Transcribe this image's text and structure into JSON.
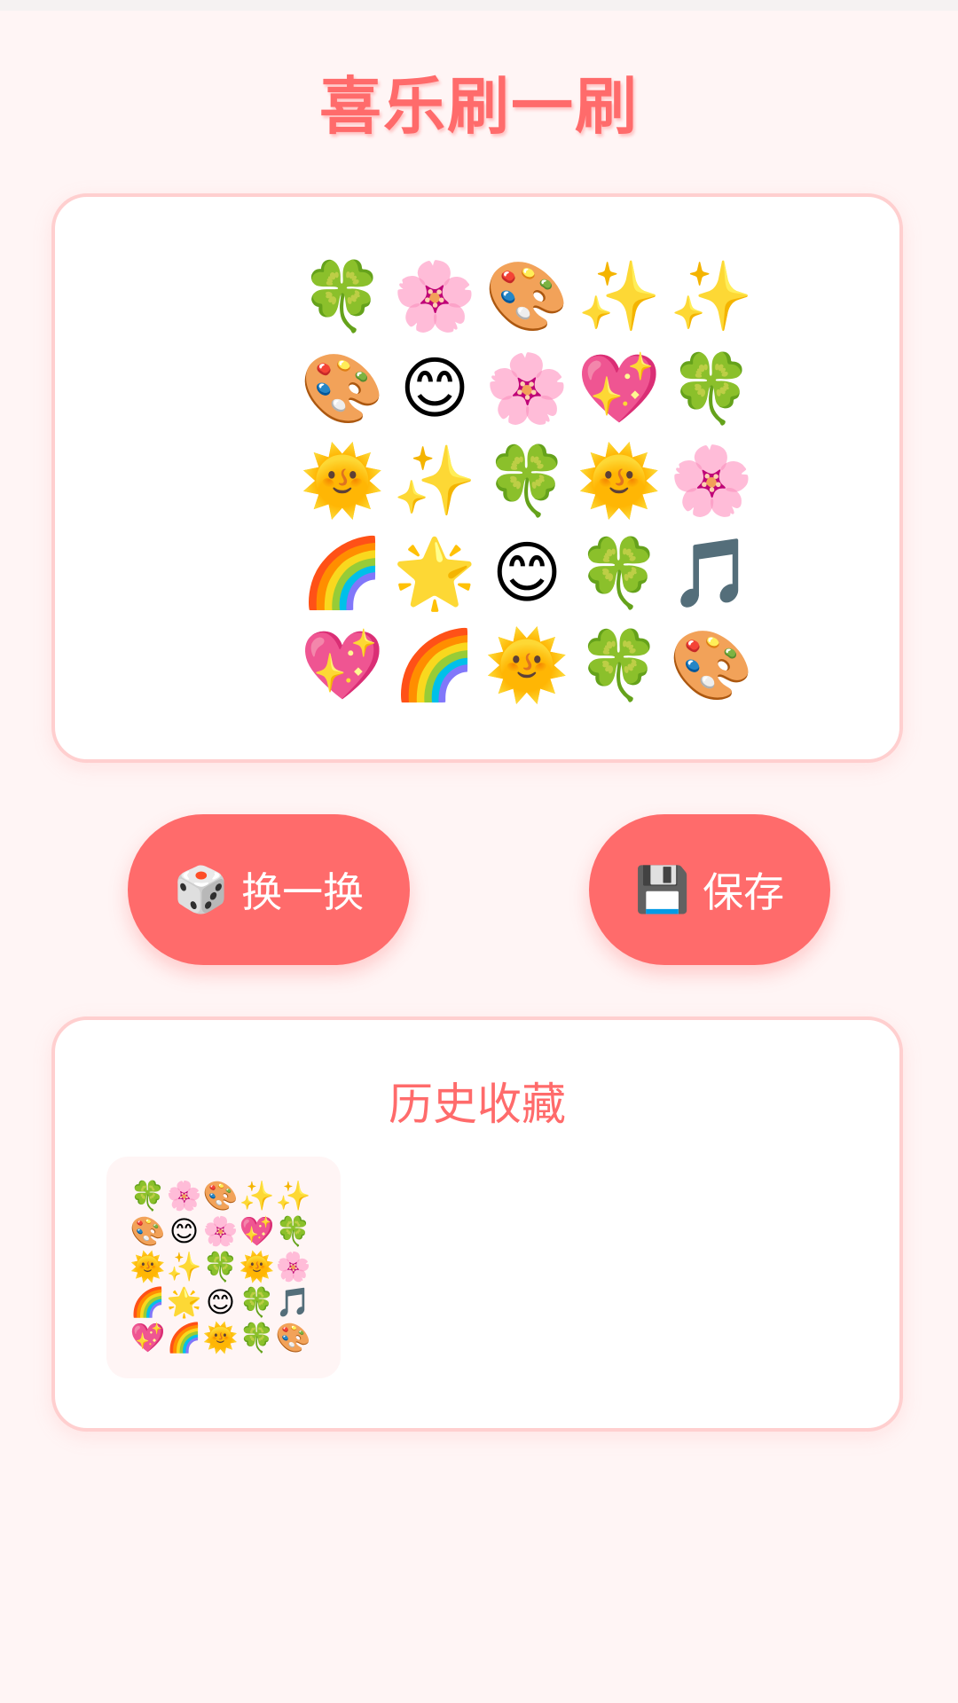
{
  "app": {
    "title": "喜乐刷一刷"
  },
  "grid": {
    "emojis": [
      [
        "🍀",
        "🌸",
        "🎨",
        "✨",
        "✨"
      ],
      [
        "🎨",
        "😊",
        "🌸",
        "💖",
        "🍀"
      ],
      [
        "🌞",
        "✨",
        "🍀",
        "🌞",
        "🌸"
      ],
      [
        "🌈",
        "🌟",
        "😊",
        "🍀",
        "🎵"
      ],
      [
        "💖",
        "🌈",
        "🌞",
        "🍀",
        "🎨"
      ]
    ]
  },
  "actions": {
    "shuffle_icon": "🎲",
    "shuffle_label": "换一换",
    "save_icon": "💾",
    "save_label": "保存"
  },
  "history": {
    "title": "历史收藏",
    "items": [
      {
        "emojis": [
          [
            "🍀",
            "🌸",
            "🎨",
            "✨",
            "✨"
          ],
          [
            "🎨",
            "😊",
            "🌸",
            "💖",
            "🍀"
          ],
          [
            "🌞",
            "✨",
            "🍀",
            "🌞",
            "🌸"
          ],
          [
            "🌈",
            "🌟",
            "😊",
            "🍀",
            "🎵"
          ],
          [
            "💖",
            "🌈",
            "🌞",
            "🍀",
            "🎨"
          ]
        ]
      }
    ]
  },
  "colors": {
    "accent": "#ff6b6b",
    "background": "#fff5f5",
    "panel_border": "#ffcfcf"
  }
}
